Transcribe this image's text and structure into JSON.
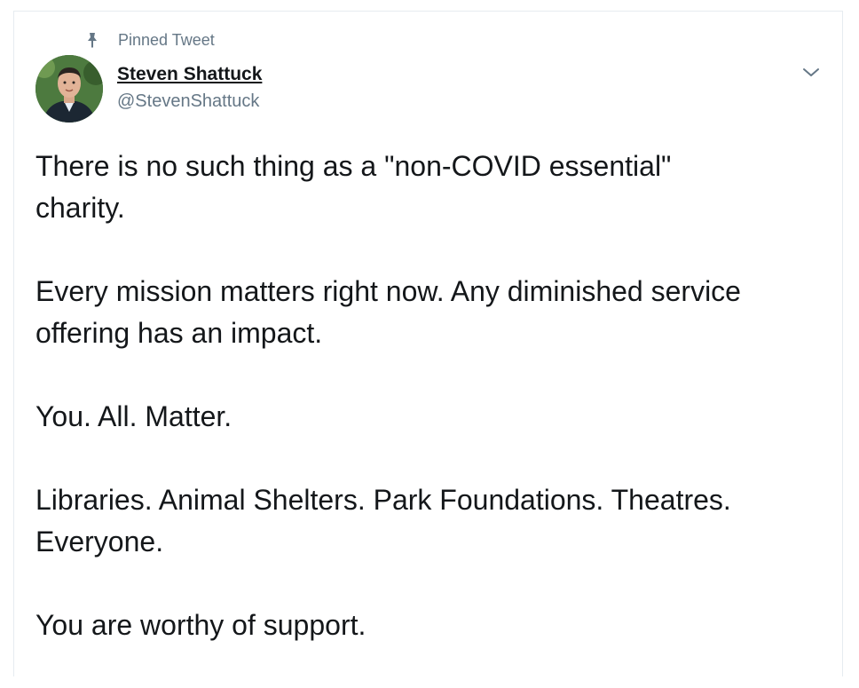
{
  "tweet": {
    "pinned_label": "Pinned Tweet",
    "author_name": "Steven Shattuck",
    "author_handle": "@StevenShattuck",
    "paragraphs": [
      "There is no such thing as a \"non-COVID essential\"\ncharity.",
      "Every mission matters right now. Any diminished service\noffering has an impact.",
      "You. All. Matter.",
      "Libraries. Animal Shelters. Park Foundations. Theatres.\nEveryone.",
      "You are worthy of support."
    ]
  },
  "icons": {
    "pin": "pin-icon",
    "chevron": "chevron-down-icon"
  },
  "colors": {
    "text": "#14171a",
    "muted": "#657786",
    "border": "#e6ecf0"
  }
}
